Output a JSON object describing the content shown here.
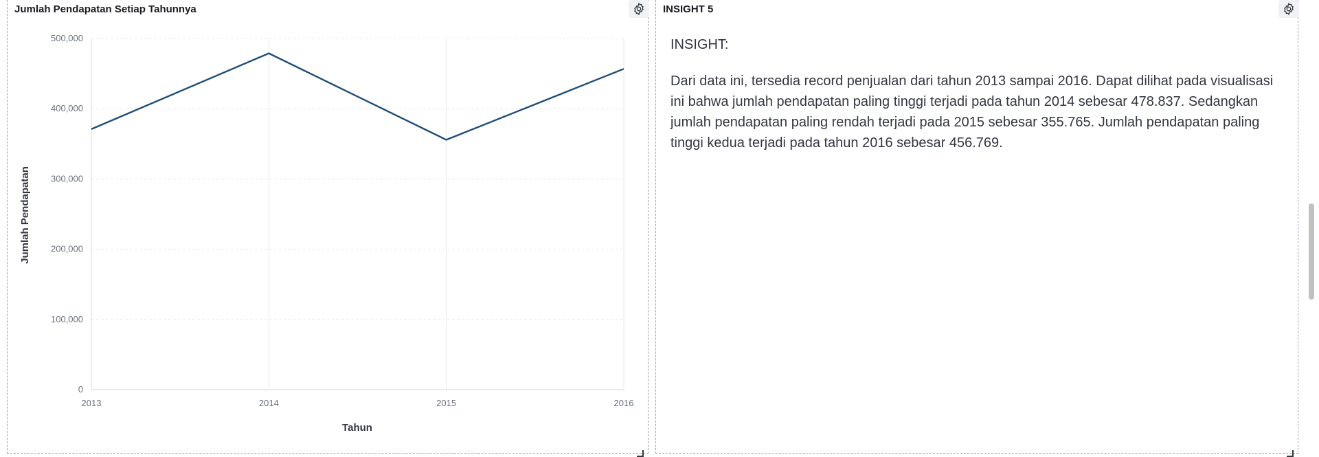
{
  "panels": {
    "chart": {
      "title": "Jumlah Pendapatan Setiap Tahunnya",
      "settings_icon": "gear-icon"
    },
    "insight": {
      "title": "INSIGHT 5",
      "settings_icon": "gear-icon",
      "heading": "INSIGHT:",
      "body": "Dari data ini, tersedia record penjualan dari tahun 2013 sampai 2016. Dapat dilihat pada visualisasi ini bahwa jumlah pendapatan paling tinggi terjadi pada tahun 2014 sebesar 478.837. Sedangkan jumlah pendapatan paling rendah terjadi pada 2015 sebesar 355.765. Jumlah pendapatan paling tinggi kedua terjadi pada tahun 2016 sebesar 456.769."
    }
  },
  "chart_data": {
    "type": "line",
    "title": "Jumlah Pendapatan Setiap Tahunnya",
    "xlabel": "Tahun",
    "ylabel": "Jumlah Pendapatan",
    "categories": [
      "2013",
      "2014",
      "2015",
      "2016"
    ],
    "series": [
      {
        "values": [
          371000,
          478837,
          355765,
          456769
        ],
        "color": "#1f4e79"
      }
    ],
    "ylim": [
      0,
      500000
    ],
    "yticks": [
      "0",
      "100,000",
      "200,000",
      "300,000",
      "400,000",
      "500,000"
    ],
    "grid": true
  },
  "colors": {
    "line": "#1f4e79",
    "grid": "#e6e8eb",
    "border": "#98a2b3"
  }
}
